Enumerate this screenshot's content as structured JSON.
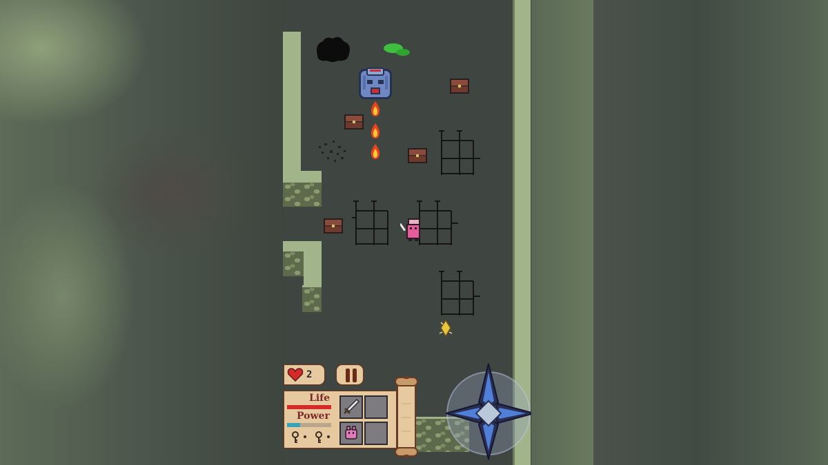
{
  "hud": {
    "hearts_count": "2",
    "life_label": "Life",
    "power_label": "Power",
    "life_fraction": 1.0,
    "power_fraction": 0.3,
    "life_color": "#d42a2a",
    "power_color": "#38a3b8"
  },
  "inventory": {
    "slot_1": "sword-icon",
    "slot_2": "empty",
    "slot_3": "pink-creature-icon",
    "slot_4": "empty"
  },
  "controls": {
    "pause": "pause-icon",
    "map": "scroll-icon",
    "dpad": "dpad-icon"
  },
  "colors": {
    "wall": "#a1b48a",
    "floor": "#3f4541",
    "hud_parchment": "#e7c9a0",
    "hud_text": "#7a2a2a"
  }
}
